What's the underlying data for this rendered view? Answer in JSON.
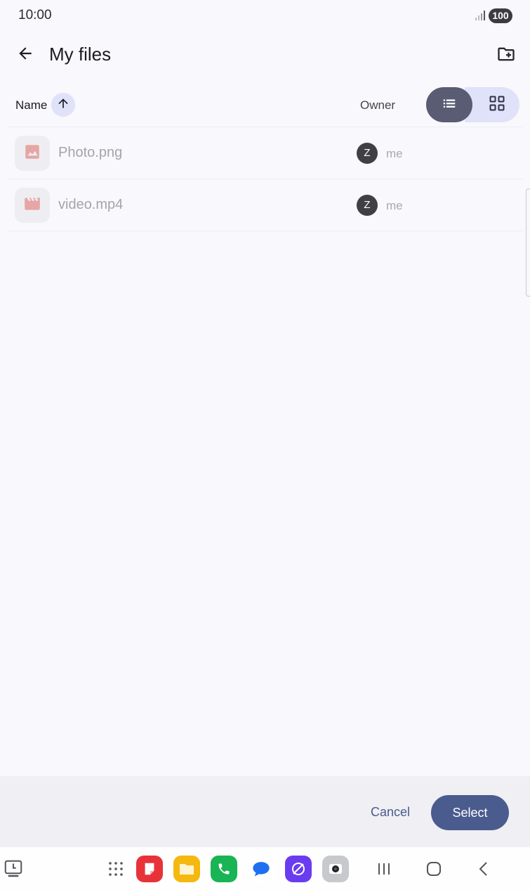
{
  "status_bar": {
    "time": "10:00",
    "battery": "100"
  },
  "app_bar": {
    "title": "My files"
  },
  "list_header": {
    "name_label": "Name",
    "owner_label": "Owner"
  },
  "files": [
    {
      "name": "Photo.png",
      "type_icon": "image-icon",
      "owner_initial": "Z",
      "owner": "me"
    },
    {
      "name": "video.mp4",
      "type_icon": "movie-icon",
      "owner_initial": "Z",
      "owner": "me"
    }
  ],
  "actions": {
    "cancel_label": "Cancel",
    "select_label": "Select"
  },
  "taskbar": {
    "apps": [
      "recent-apps-icon",
      "app-drawer-icon",
      "notes-app-icon",
      "files-app-icon",
      "phone-app-icon",
      "messages-app-icon",
      "internet-app-icon",
      "camera-app-icon"
    ],
    "nav": [
      "recents-nav-icon",
      "home-nav-icon",
      "back-nav-icon"
    ]
  },
  "colors": {
    "accent": "#4a5b8e",
    "chip_bg": "#dfe2f8",
    "list_toggle_active": "#595c73",
    "file_icon": "#e6a6a6"
  }
}
